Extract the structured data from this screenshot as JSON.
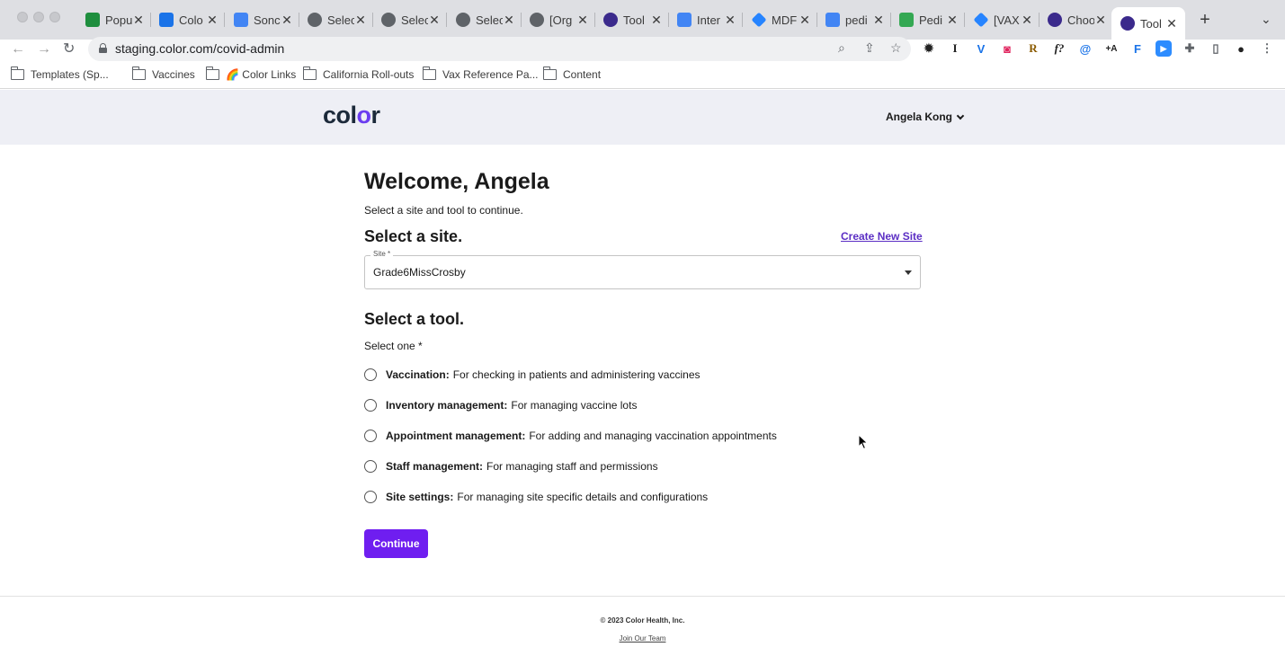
{
  "browser": {
    "tabs": [
      {
        "title": "Popu",
        "icon": "sheets-icon",
        "color": "#1e8e3e"
      },
      {
        "title": "Colo",
        "icon": "calendar-icon",
        "color": "#1a73e8"
      },
      {
        "title": "Sonc",
        "icon": "docs-icon",
        "color": "#4285f4"
      },
      {
        "title": "Selec",
        "icon": "globe-icon",
        "color": "#5f6368"
      },
      {
        "title": "Selec",
        "icon": "globe-icon",
        "color": "#5f6368"
      },
      {
        "title": "Selec",
        "icon": "globe-icon",
        "color": "#5f6368"
      },
      {
        "title": "[Org",
        "icon": "globe-icon",
        "color": "#5f6368"
      },
      {
        "title": "Tool",
        "icon": "color-icon",
        "color": "#3b2a8c"
      },
      {
        "title": "Inter",
        "icon": "docs-icon",
        "color": "#4285f4"
      },
      {
        "title": "MDF",
        "icon": "jira-icon",
        "color": "#2684ff"
      },
      {
        "title": "pedi",
        "icon": "google-icon",
        "color": "#4285f4"
      },
      {
        "title": "Pedi",
        "icon": "sheet-r-icon",
        "color": "#34a853"
      },
      {
        "title": "[VAX",
        "icon": "jira-icon",
        "color": "#2684ff"
      },
      {
        "title": "Choo",
        "icon": "color-icon",
        "color": "#3b2a8c"
      }
    ],
    "active_tab": {
      "title": "Tool",
      "icon": "color-icon"
    },
    "url": "staging.color.com/covid-admin",
    "bookmarks": [
      {
        "label": "Templates (Sp...",
        "icon": "folder-icon"
      },
      {
        "label": "Vaccines",
        "icon": "folder-icon"
      },
      {
        "label": "🌈 Color Links",
        "icon": "folder-icon"
      },
      {
        "label": "California Roll-outs",
        "icon": "folder-icon"
      },
      {
        "label": "Vax Reference Pa...",
        "icon": "folder-icon"
      },
      {
        "label": "Content",
        "icon": "folder-icon"
      }
    ]
  },
  "header": {
    "logo_text": "color",
    "user_name": "Angela Kong"
  },
  "main": {
    "welcome": "Welcome, Angela",
    "subtitle": "Select a site and tool to continue.",
    "site_heading": "Select a site.",
    "create_site_link": "Create New Site",
    "site_field_label": "Site *",
    "site_value": "Grade6MissCrosby",
    "tool_heading": "Select a tool.",
    "select_one": "Select one *",
    "tools": [
      {
        "name": "Vaccination:",
        "desc": "For checking in patients and administering vaccines"
      },
      {
        "name": "Inventory management:",
        "desc": "For managing vaccine lots"
      },
      {
        "name": "Appointment management:",
        "desc": "For adding and managing vaccination appointments"
      },
      {
        "name": "Staff management:",
        "desc": "For managing staff and permissions"
      },
      {
        "name": "Site settings:",
        "desc": "For managing site specific details and configurations"
      }
    ],
    "continue_label": "Continue"
  },
  "footer": {
    "copyright": "© 2023 Color Health, Inc.",
    "join": "Join Our Team"
  },
  "colors": {
    "accent": "#6f1ef0",
    "link": "#5b2ec4",
    "header_bg": "#eeeff5"
  }
}
